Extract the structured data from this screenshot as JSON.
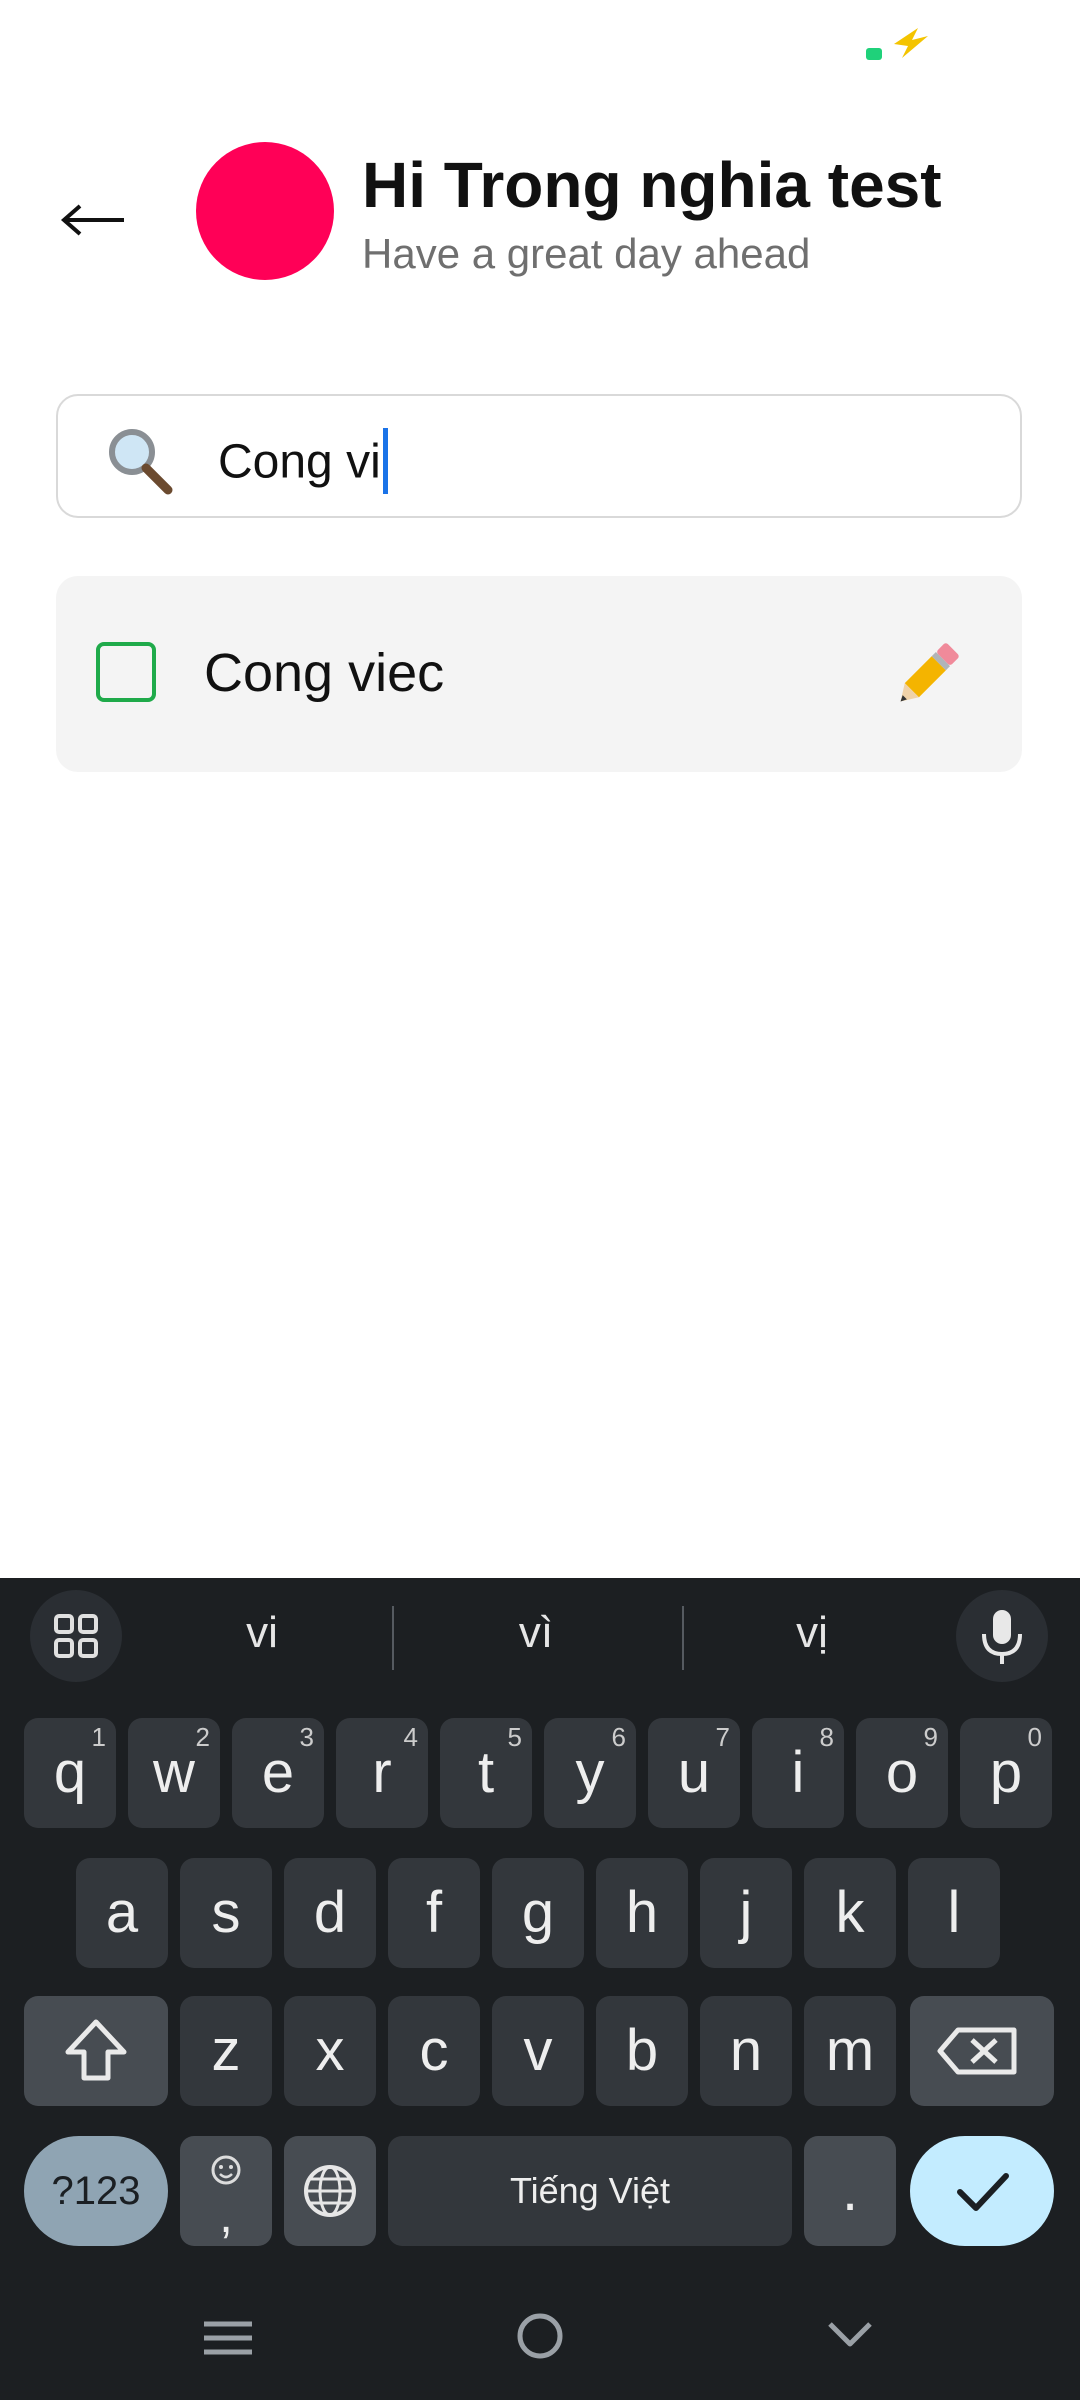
{
  "status": {
    "battery_icon": "battery-charging-icon"
  },
  "header": {
    "title": "Hi Trong nghia test",
    "subtitle": "Have a great day ahead",
    "avatar_color": "#ff0057"
  },
  "search": {
    "value": "Cong vi"
  },
  "tasks": [
    {
      "label": "Cong viec",
      "checked": false
    }
  ],
  "keyboard": {
    "suggestions": [
      "vi",
      "vì",
      "vị"
    ],
    "row1": [
      {
        "k": "q",
        "n": "1"
      },
      {
        "k": "w",
        "n": "2"
      },
      {
        "k": "e",
        "n": "3"
      },
      {
        "k": "r",
        "n": "4"
      },
      {
        "k": "t",
        "n": "5"
      },
      {
        "k": "y",
        "n": "6"
      },
      {
        "k": "u",
        "n": "7"
      },
      {
        "k": "i",
        "n": "8"
      },
      {
        "k": "o",
        "n": "9"
      },
      {
        "k": "p",
        "n": "0"
      }
    ],
    "row2": [
      "a",
      "s",
      "d",
      "f",
      "g",
      "h",
      "j",
      "k",
      "l"
    ],
    "row3": [
      "z",
      "x",
      "c",
      "v",
      "b",
      "n",
      "m"
    ],
    "symbols_label": "?123",
    "emoji_comma_label": ",",
    "space_label": "Tiếng Việt",
    "period_label": "."
  },
  "colors": {
    "accent": "#1a73e8",
    "check_border": "#1faa4a",
    "keyboard_bg": "#1c1f22"
  }
}
